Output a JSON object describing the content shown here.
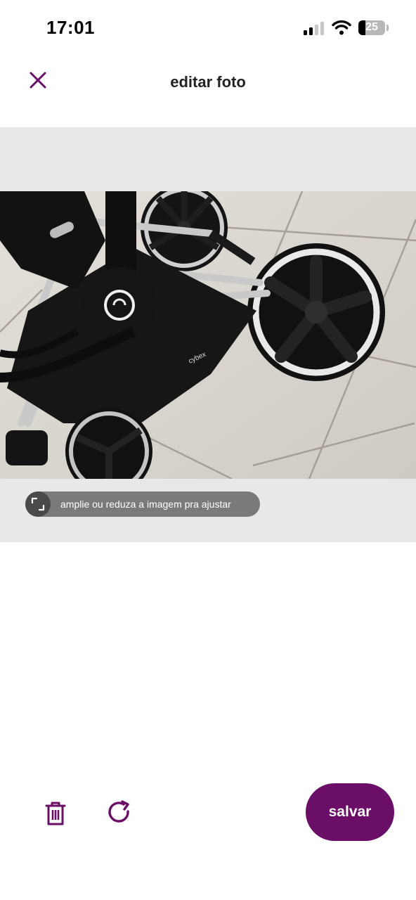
{
  "status_bar": {
    "time": "17:01",
    "battery_level": "25",
    "battery_fraction": 0.25,
    "signal_bars_active": 2,
    "signal_bars_total": 4
  },
  "header": {
    "title": "editar foto",
    "close_icon": "close-icon"
  },
  "editor": {
    "photo": "stroller-photo",
    "hint_icon": "resize-icon",
    "hint_text": "amplie ou reduza a imagem pra ajustar"
  },
  "toolbar": {
    "delete_icon": "trash-icon",
    "rotate_icon": "rotate-icon",
    "save_label": "salvar"
  },
  "colors": {
    "accent": "#6b0e68",
    "editor_background": "#e8e8e8",
    "hint_pill": "#7a7a7a"
  }
}
